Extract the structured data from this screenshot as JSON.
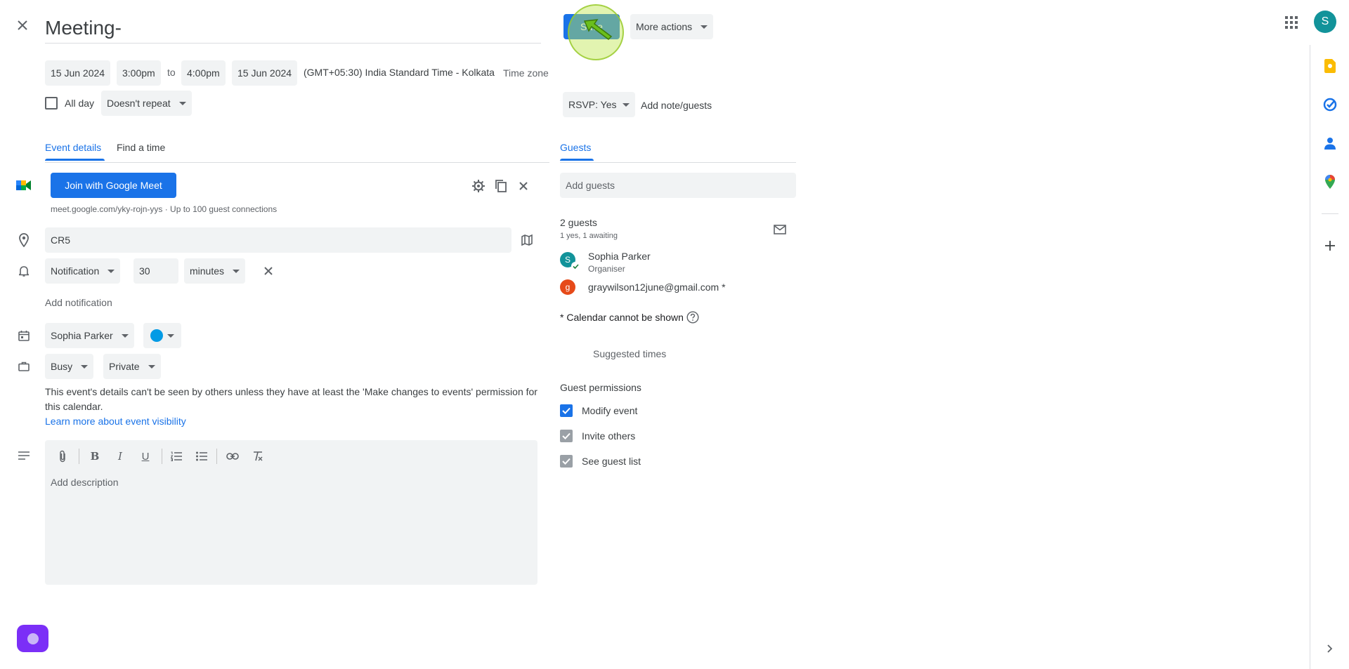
{
  "header": {
    "title": "Meeting-",
    "save_label": "Save",
    "more_actions_label": "More actions",
    "avatar_letter": "S"
  },
  "datetime": {
    "start_date": "15 Jun 2024",
    "start_time": "3:00pm",
    "to_label": "to",
    "end_time": "4:00pm",
    "end_date": "15 Jun 2024",
    "timezone": "(GMT+05:30) India Standard Time - Kolkata",
    "timezone_link": "Time zone",
    "all_day_label": "All day",
    "repeat": "Doesn't repeat"
  },
  "rsvp": {
    "value": "RSVP: Yes",
    "add_note_label": "Add note/guests"
  },
  "tabs": {
    "event_details": "Event details",
    "find_a_time": "Find a time",
    "guests": "Guests"
  },
  "meet": {
    "join_label": "Join with Google Meet",
    "link_text": "meet.google.com/yky-rojn-yys · Up to 100 guest connections"
  },
  "location": {
    "value": "CR5"
  },
  "notification": {
    "type": "Notification",
    "amount": "30",
    "unit": "minutes",
    "add_label": "Add notification"
  },
  "calendar": {
    "owner": "Sophia Parker",
    "color": "#039be5"
  },
  "availability": {
    "status": "Busy",
    "visibility": "Private"
  },
  "visibility_note": {
    "text": "This event's details can't be seen by others unless they have at least the 'Make changes to events' permission for this calendar.",
    "link": "Learn more about event visibility"
  },
  "description": {
    "placeholder": "Add description"
  },
  "guests": {
    "add_placeholder": "Add guests",
    "count_label": "2 guests",
    "summary": "1 yes, 1 awaiting",
    "list": [
      {
        "initial": "S",
        "name": "Sophia Parker",
        "role": "Organiser",
        "color": "#12939a"
      },
      {
        "initial": "g",
        "name": "graywilson12june@gmail.com *",
        "role": "",
        "color": "#e64a19"
      }
    ],
    "calendar_note": "* Calendar cannot be shown",
    "suggested_times": "Suggested times",
    "permissions_title": "Guest permissions",
    "permissions": [
      {
        "label": "Modify event",
        "checked": true
      },
      {
        "label": "Invite others",
        "checked": true
      },
      {
        "label": "See guest list",
        "checked": true
      }
    ]
  },
  "colors": {
    "accent": "#1a73e8",
    "save_button": "#1a73e8",
    "chip_bg": "#f1f3f4",
    "assistant_button": "#7b2ff7"
  }
}
